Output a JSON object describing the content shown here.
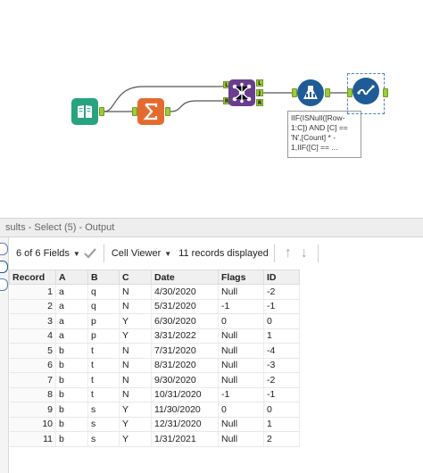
{
  "workflow": {
    "annotation": "IIF(ISNull([Row-\n1:C]) AND [C] ==\n'N',[Count] * -\n1,IIF([C] == ...",
    "tools": [
      {
        "name": "input-data",
        "icon": "book-icon"
      },
      {
        "name": "summarize",
        "icon": "sigma-icon"
      },
      {
        "name": "join",
        "icon": "join-icon"
      },
      {
        "name": "multi-row-formula",
        "icon": "flask-icon"
      },
      {
        "name": "select",
        "icon": "checkmark-wave-icon"
      }
    ],
    "join_anchors": {
      "left": "L",
      "right": "R",
      "out_left": "L",
      "out_join": "J",
      "out_right": "R"
    }
  },
  "results": {
    "title": "sults - Select (5) - Output",
    "fields_label": "6 of 6 Fields",
    "viewer_label": "Cell Viewer",
    "records_label": "11 records displayed",
    "columns": [
      "Record",
      "A",
      "B",
      "C",
      "Date",
      "Flags",
      "ID"
    ],
    "rows": [
      [
        "1",
        "a",
        "q",
        "N",
        "4/30/2020",
        "Null",
        "-2"
      ],
      [
        "2",
        "a",
        "q",
        "N",
        "5/31/2020",
        "-1",
        "-1"
      ],
      [
        "3",
        "a",
        "p",
        "Y",
        "6/30/2020",
        "0",
        "0"
      ],
      [
        "4",
        "a",
        "p",
        "Y",
        "3/31/2022",
        "Null",
        "1"
      ],
      [
        "5",
        "b",
        "t",
        "N",
        "7/31/2020",
        "Null",
        "-4"
      ],
      [
        "6",
        "b",
        "t",
        "N",
        "8/31/2020",
        "Null",
        "-3"
      ],
      [
        "7",
        "b",
        "t",
        "N",
        "9/30/2020",
        "Null",
        "-2"
      ],
      [
        "8",
        "b",
        "t",
        "N",
        "10/31/2020",
        "-1",
        "-1"
      ],
      [
        "9",
        "b",
        "s",
        "Y",
        "11/30/2020",
        "0",
        "0"
      ],
      [
        "10",
        "b",
        "s",
        "Y",
        "12/31/2020",
        "Null",
        "1"
      ],
      [
        "11",
        "b",
        "s",
        "Y",
        "1/31/2021",
        "Null",
        "2"
      ]
    ]
  },
  "colors": {
    "input_tool": "#28a37f",
    "summarize_tool": "#e56a30",
    "join_tool": "#6a3e8e",
    "formula_tool": "#1f5b97",
    "anchor": "#9ccc3c"
  }
}
